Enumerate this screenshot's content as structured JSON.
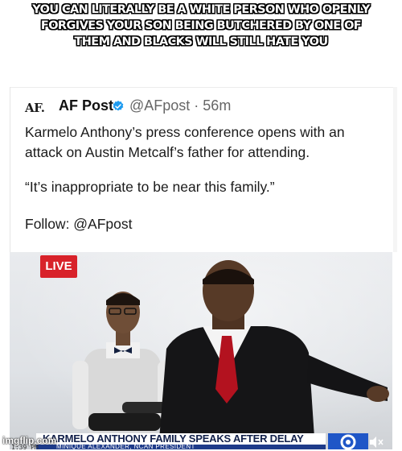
{
  "caption": {
    "lines": [
      "YOU CAN LITERALLY BE A WHITE PERSON WHO OPENLY",
      "FORGIVES YOUR SON BEING BUTCHERED BY ONE OF",
      "THEM AND BLACKS WILL STILL HATE YOU"
    ]
  },
  "tweet": {
    "logo": "AF.",
    "account_name": "AF Post",
    "handle_time": "@AFpost · 56m",
    "line1": "Karmelo Anthony’s press conference opens with an",
    "line2": "attack on Austin Metcalf’s father for attending.",
    "quote": "“It’s inappropriate to be near this family.”",
    "follow": "Follow: @AFpost",
    "verified_color": "#1d9bf0"
  },
  "video": {
    "live_badge": "LIVE",
    "headline": "KARMELO ANTHONY FAMILY SPEAKS AFTER DELAY",
    "subline": "MINIQUE ALEXANDER, NCAN PRESIDENT",
    "timecode": "1:39 PM",
    "live_color": "#d8222a",
    "station_color": "#1f56c7"
  },
  "watermark": "imgflip.com"
}
